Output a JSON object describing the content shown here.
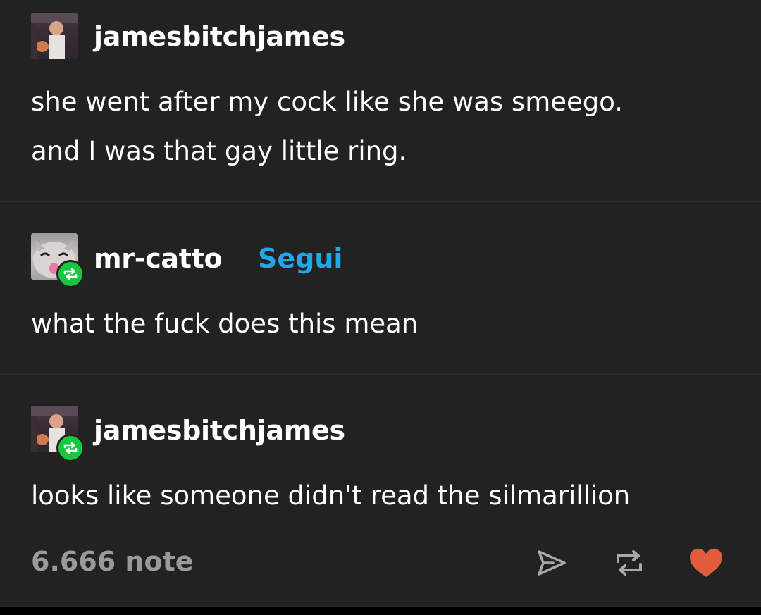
{
  "posts": [
    {
      "username": "jamesbitchjames",
      "lines": [
        "she went after my cock like she was smeego.",
        "and I was that gay little ring."
      ]
    },
    {
      "username": "mr-catto",
      "follow_label": "Segui",
      "lines": [
        "what the fuck does this mean"
      ]
    },
    {
      "username": "jamesbitchjames",
      "lines": [
        "looks like someone didn't read the silmarillion"
      ]
    }
  ],
  "footer": {
    "notes": "6.666 note",
    "icons": [
      "share-icon",
      "reblog-icon",
      "like-icon"
    ]
  },
  "colors": {
    "background": "#222222",
    "follow_link": "#1fa8e6",
    "reblog_badge": "#17c83f",
    "like": "#e05c3a",
    "muted": "#9a9a9a"
  }
}
